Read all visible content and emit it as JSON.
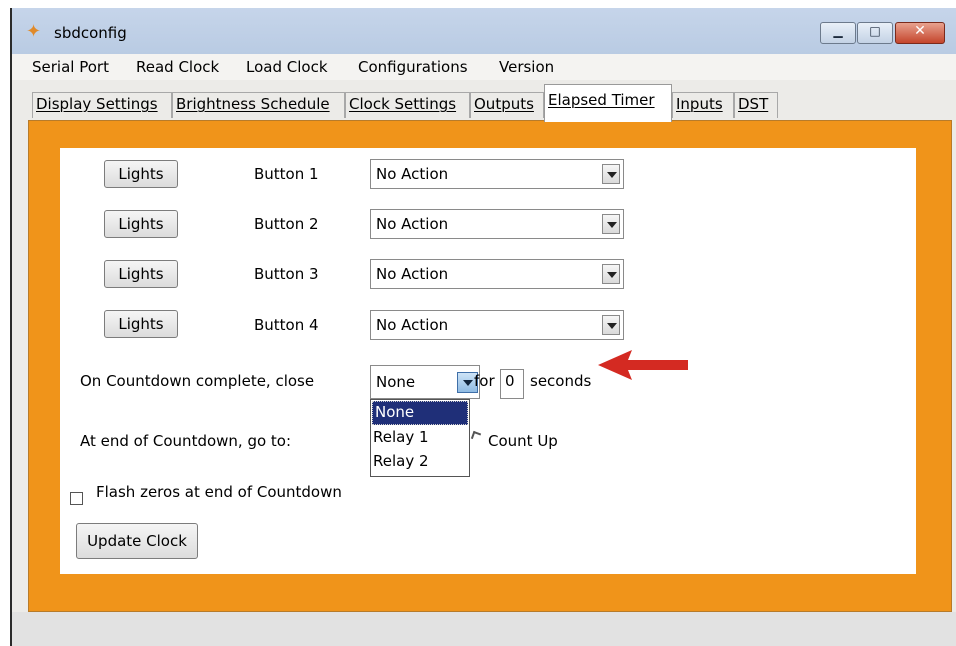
{
  "window": {
    "title": "sbdconfig",
    "controls": {
      "minimize": "▁",
      "maximize": "□",
      "close": "✕"
    }
  },
  "menubar": [
    "Serial Port",
    "Read Clock",
    "Load Clock",
    "Configurations",
    "Version"
  ],
  "tabs": [
    {
      "label": "Display Settings",
      "active": false
    },
    {
      "label": "Brightness Schedule",
      "active": false
    },
    {
      "label": "Clock Settings",
      "active": false
    },
    {
      "label": "Outputs",
      "active": false
    },
    {
      "label": "Elapsed Timer",
      "active": true
    },
    {
      "label": "Inputs",
      "active": false
    },
    {
      "label": "DST",
      "active": false
    }
  ],
  "buttons_rows": [
    {
      "button": "Lights",
      "label": "Button 1",
      "action": "No Action"
    },
    {
      "button": "Lights",
      "label": "Button 2",
      "action": "No Action"
    },
    {
      "button": "Lights",
      "label": "Button 3",
      "action": "No Action"
    },
    {
      "button": "Lights",
      "label": "Button 4",
      "action": "No Action"
    }
  ],
  "countdown": {
    "label": "On Countdown complete, close",
    "relay_value": "None",
    "for_label": "for",
    "seconds_value": "0",
    "seconds_label": "seconds",
    "options": [
      "None",
      "Relay 1",
      "Relay 2"
    ]
  },
  "end_countdown": {
    "label": "At end of Countdown, go to:",
    "count_up_label": "Count Up"
  },
  "flash_zeros": {
    "label": "Flash zeros at end of Countdown",
    "checked": false
  },
  "update_button": "Update Clock",
  "colors": {
    "tab_background": "#f0941a",
    "arrow": "#d42a22",
    "selected_option": "#1f2f78"
  }
}
